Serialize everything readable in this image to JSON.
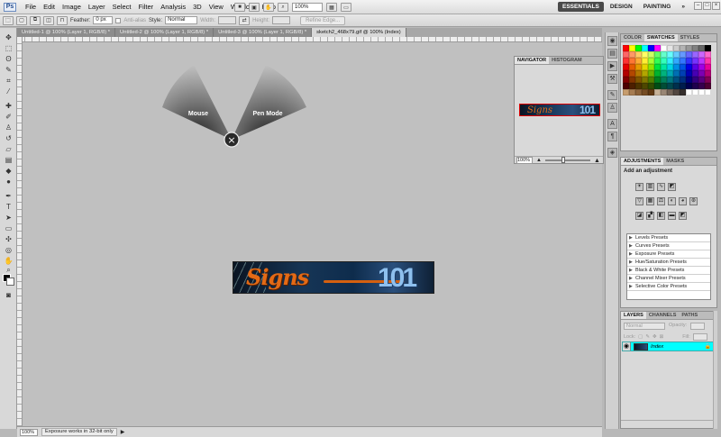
{
  "menubar": {
    "logo": "Ps",
    "menus": [
      "File",
      "Edit",
      "Image",
      "Layer",
      "Select",
      "Filter",
      "Analysis",
      "3D",
      "View",
      "Window",
      "Help"
    ],
    "zoom": "100%",
    "workspaces": [
      "ESSENTIALS",
      "DESIGN",
      "PAINTING"
    ],
    "more": "»",
    "cs_live": "CS Live"
  },
  "options": {
    "feather_label": "Feather:",
    "feather_value": "0 px",
    "antialias_label": "Anti-alias",
    "style_label": "Style:",
    "style_value": "Normal",
    "width_label": "Width:",
    "height_label": "Height:",
    "refine_label": "Refine Edge..."
  },
  "doc_tabs": [
    {
      "label": "Untitled-1 @ 100% (Layer 1, RGB/8) *",
      "active": false
    },
    {
      "label": "Untitled-2 @ 100% (Layer 1, RGB/8) *",
      "active": false
    },
    {
      "label": "Untitled-3 @ 100% (Layer 1, RGB/8) *",
      "active": false
    },
    {
      "label": "sketch2_468x79.gif @ 100% (Index)",
      "active": true
    }
  ],
  "gesture": {
    "left": "Mouse",
    "right": "Pen Mode",
    "close": "×"
  },
  "artwork": {
    "script": "Signs",
    "number": "101"
  },
  "status": {
    "zoom": "100%",
    "message": "Exposure works in 32-bit only"
  },
  "navigator": {
    "tabs": [
      "NAVIGATOR",
      "HISTOGRAM"
    ],
    "zoom": "100%"
  },
  "swatches": {
    "tabs": [
      "COLOR",
      "SWATCHES",
      "STYLES"
    ],
    "colors": [
      "#ff0000",
      "#ffff00",
      "#00ff00",
      "#00ffff",
      "#0000ff",
      "#ff00ff",
      "#ffffff",
      "#e6e6e6",
      "#cccccc",
      "#b3b3b3",
      "#999999",
      "#808080",
      "#666666",
      "#000000",
      "#ff6666",
      "#ff9966",
      "#ffcc66",
      "#ffff66",
      "#ccff66",
      "#66ff66",
      "#66ffcc",
      "#66ffff",
      "#66ccff",
      "#6699ff",
      "#6666ff",
      "#9966ff",
      "#cc66ff",
      "#ff66cc",
      "#ff3333",
      "#ff7733",
      "#ffaa33",
      "#ffee33",
      "#aaff33",
      "#33ff55",
      "#33ffbb",
      "#33eeff",
      "#33aaff",
      "#3377ff",
      "#3333ff",
      "#7733ff",
      "#bb33ff",
      "#ff33aa",
      "#e60000",
      "#e65c00",
      "#e69900",
      "#e6d600",
      "#8fe600",
      "#00e63d",
      "#00e6a1",
      "#00d6e6",
      "#008fe6",
      "#0052e6",
      "#0000e6",
      "#5c00e6",
      "#a100e6",
      "#e60099",
      "#b30000",
      "#b34700",
      "#b37700",
      "#b3a600",
      "#6fb300",
      "#00b32f",
      "#00b37d",
      "#00a6b3",
      "#006fb3",
      "#0040b3",
      "#0000b3",
      "#4700b3",
      "#7d00b3",
      "#b30077",
      "#800000",
      "#803300",
      "#805500",
      "#807700",
      "#508000",
      "#008022",
      "#00805a",
      "#007780",
      "#005080",
      "#002e80",
      "#000080",
      "#330080",
      "#5a0080",
      "#800055",
      "#4d0000",
      "#4d1f00",
      "#4d3300",
      "#4d4700",
      "#304d00",
      "#004d14",
      "#004d36",
      "#00474d",
      "#00304d",
      "#001c4d",
      "#00004d",
      "#1f004d",
      "#36004d",
      "#4d0033",
      "#c69c6d",
      "#a67c52",
      "#8c6239",
      "#754c24",
      "#603913",
      "#c7b299",
      "#998675",
      "#736357",
      "#534741",
      "#362f2d",
      "#ffffff",
      "#ffffff",
      "#ffffff",
      "#ffffff"
    ]
  },
  "adjustments": {
    "tabs": [
      "ADJUSTMENTS",
      "MASKS"
    ],
    "title": "Add an adjustment",
    "presets": [
      "Levels Presets",
      "Curves Presets",
      "Exposure Presets",
      "Hue/Saturation Presets",
      "Black & White Presets",
      "Channel Mixer Presets",
      "Selective Color Presets"
    ]
  },
  "layers": {
    "tabs": [
      "LAYERS",
      "CHANNELS",
      "PATHS"
    ],
    "blend": "Normal",
    "opacity_label": "Opacity:",
    "lock_label": "Lock:",
    "fill_label": "Fill:",
    "layer_name": "Index"
  }
}
